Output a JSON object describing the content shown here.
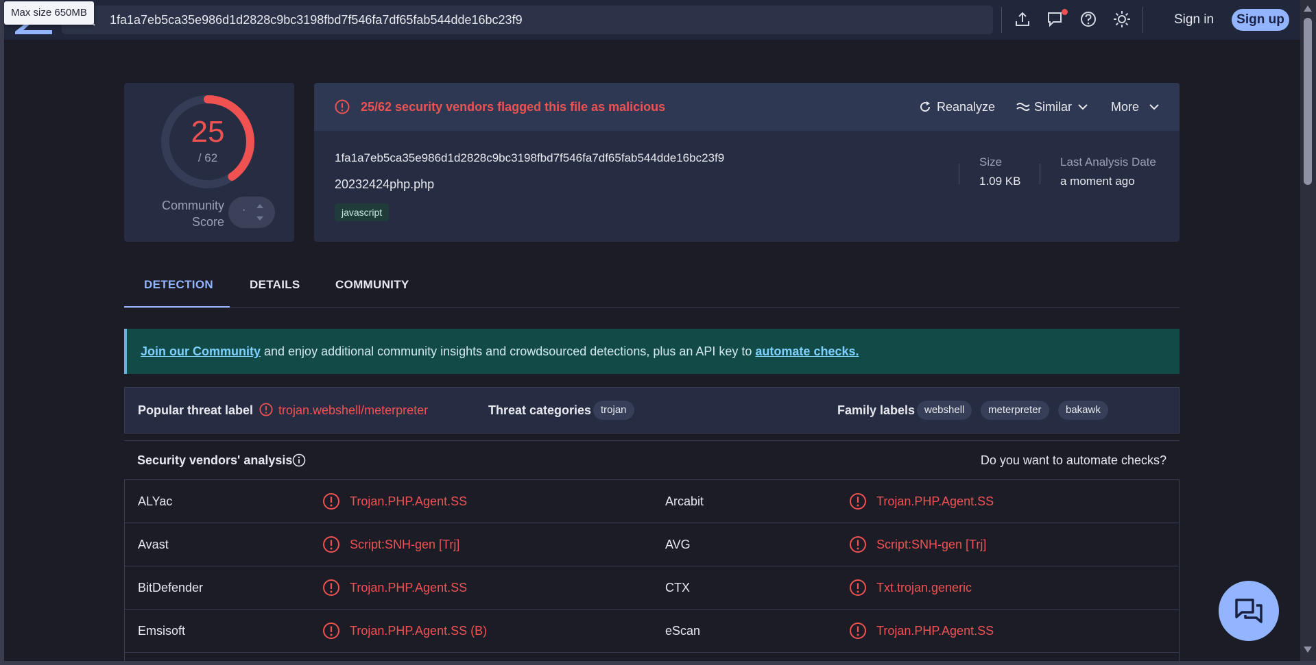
{
  "tooltip": "Max size 650MB",
  "search": {
    "value": "1fa1a7eb5ca35e986d1d2828c9bc3198fbd7f546fa7df65fab544dde16bc23f9"
  },
  "auth": {
    "signin": "Sign in",
    "signup": "Sign up"
  },
  "score": {
    "detected": "25",
    "total": "/ 62",
    "community_label_1": "Community",
    "community_label_2": "Score",
    "vote_dot": "·"
  },
  "alert": "25/62 security vendors flagged this file as malicious",
  "actions": {
    "reanalyze": "Reanalyze",
    "similar": "Similar",
    "more": "More"
  },
  "file": {
    "hash": "1fa1a7eb5ca35e986d1d2828c9bc3198fbd7f546fa7df65fab544dde16bc23f9",
    "name": "20232424php.php",
    "tag": "javascript",
    "size_label": "Size",
    "size_value": "1.09 KB",
    "date_label": "Last Analysis Date",
    "date_value": "a moment ago"
  },
  "tabs": [
    "DETECTION",
    "DETAILS",
    "COMMUNITY"
  ],
  "banner": {
    "link1": "Join our Community",
    "text": " and enjoy additional community insights and crowdsourced detections, plus an API key to ",
    "link2": "automate checks."
  },
  "threat": {
    "popular_label": "Popular threat label",
    "popular_value": "trojan.webshell/meterpreter",
    "categories_label": "Threat categories",
    "categories": [
      "trojan"
    ],
    "family_label": "Family labels",
    "families": [
      "webshell",
      "meterpreter",
      "bakawk"
    ]
  },
  "vendors_header": {
    "title": "Security vendors' analysis",
    "cta": "Do you want to automate checks?"
  },
  "vendors": [
    {
      "left_name": "ALYac",
      "left_result": "Trojan.PHP.Agent.SS",
      "right_name": "Arcabit",
      "right_result": "Trojan.PHP.Agent.SS"
    },
    {
      "left_name": "Avast",
      "left_result": "Script:SNH-gen [Trj]",
      "right_name": "AVG",
      "right_result": "Script:SNH-gen [Trj]"
    },
    {
      "left_name": "BitDefender",
      "left_result": "Trojan.PHP.Agent.SS",
      "right_name": "CTX",
      "right_result": "Txt.trojan.generic"
    },
    {
      "left_name": "Emsisoft",
      "left_result": "Trojan.PHP.Agent.SS (B)",
      "right_name": "eScan",
      "right_result": "Trojan.PHP.Agent.SS"
    }
  ],
  "colors": {
    "accent": "#93b4ff",
    "malicious": "#f05252",
    "banner_bg": "#124a48"
  }
}
